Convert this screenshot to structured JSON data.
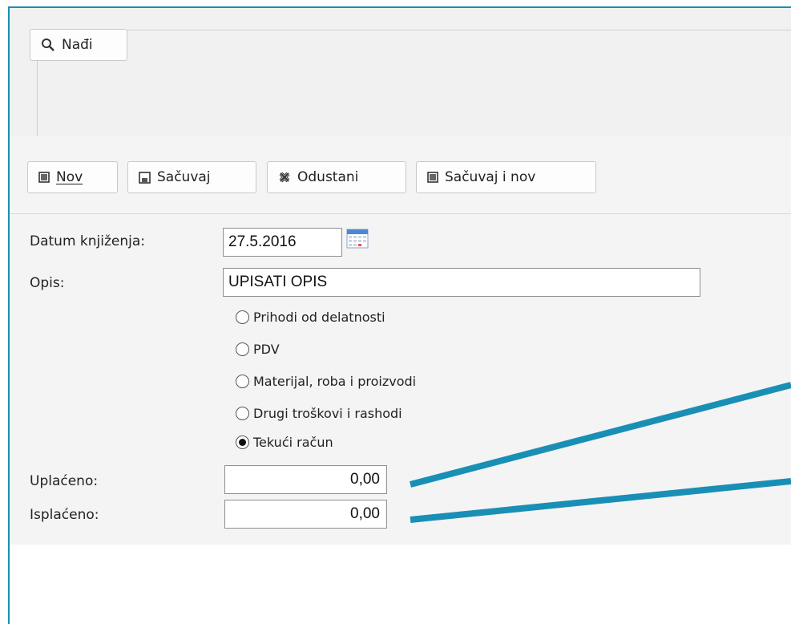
{
  "search": {
    "find_label": "Nađi",
    "find_icon": "search-icon"
  },
  "toolbar": {
    "new_label": "Nov",
    "save_label": "Sačuvaj",
    "cancel_label": "Odustani",
    "save_new_label": "Sačuvaj i nov"
  },
  "form": {
    "date_label": "Datum knjiženja:",
    "date_value": "27.5.2016",
    "desc_label": "Opis:",
    "desc_value": "UPISATI OPIS",
    "options": [
      {
        "label": "Prihodi od delatnosti",
        "selected": false
      },
      {
        "label": "PDV",
        "selected": false
      },
      {
        "label": "Materijal, roba i proizvodi",
        "selected": false
      },
      {
        "label": "Drugi troškovi i rashodi",
        "selected": false
      },
      {
        "label": "Tekući račun",
        "selected": true
      }
    ],
    "paid_in_label": "Uplaćeno:",
    "paid_in_value": "0,00",
    "paid_out_label": "Isplaćeno:",
    "paid_out_value": "0,00"
  },
  "colors": {
    "accent": "#1a8fb5",
    "panel": "#f4f4f4"
  }
}
